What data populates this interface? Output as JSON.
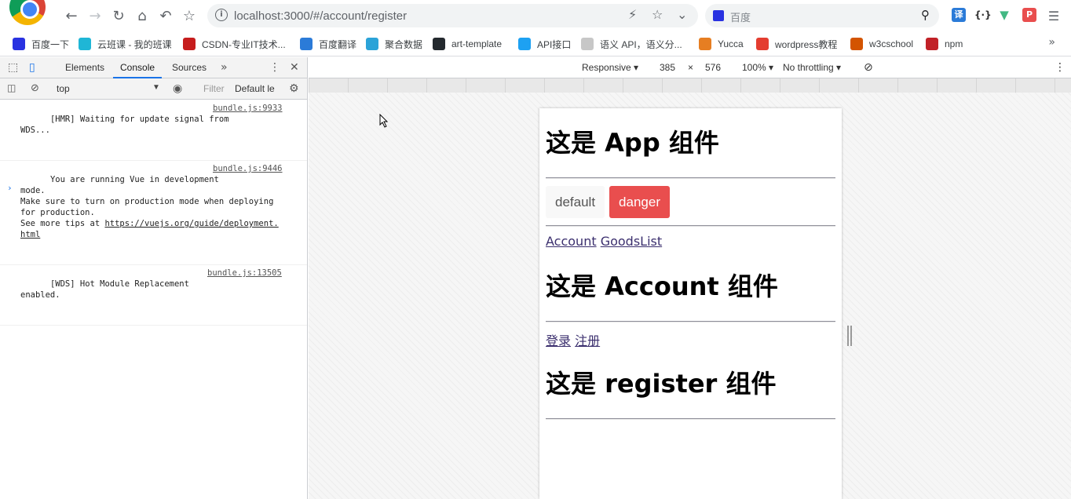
{
  "browser": {
    "url": "localhost:3000/#/account/register",
    "search_placeholder": "百度"
  },
  "bookmarks": [
    {
      "label": "百度一下",
      "color": "#2932e1"
    },
    {
      "label": "云班课 - 我的班课",
      "color": "#1fb6d6"
    },
    {
      "label": "CSDN-专业IT技术...",
      "color": "#c61d1d"
    },
    {
      "label": "百度翻译",
      "color": "#2b7bd8"
    },
    {
      "label": "聚合数据",
      "color": "#2ba3d8"
    },
    {
      "label": "art-template",
      "color": "#24292e"
    },
    {
      "label": "API接口",
      "color": "#1da1f2"
    },
    {
      "label": "语义 API，语义分...",
      "color": "#c7c7c7"
    },
    {
      "label": "Yucca",
      "color": "#e67e22"
    },
    {
      "label": "wordpress教程",
      "color": "#e43d30"
    },
    {
      "label": "w3cschool",
      "color": "#d35400"
    },
    {
      "label": "npm",
      "color": "#c12127"
    }
  ],
  "devtools": {
    "tabs": [
      "Elements",
      "Console",
      "Sources"
    ],
    "active_tab": "Console",
    "context": "top",
    "filter_placeholder": "Filter",
    "levels": "Default le",
    "messages": [
      {
        "text": "[HMR] Waiting for update signal from\nWDS...",
        "source": "bundle.js:9933"
      },
      {
        "text": "You are running Vue in development\nmode.\nMake sure to turn on production mode when deploying\nfor production.\nSee more tips at ",
        "link": "https://vuejs.org/guide/deployment.\nhtml",
        "source": "bundle.js:9446"
      },
      {
        "text": "[WDS] Hot Module Replacement\nenabled.",
        "source": "bundle.js:13505"
      }
    ]
  },
  "device_toolbar": {
    "mode": "Responsive",
    "width": "385",
    "height": "576",
    "zoom": "100%",
    "throttle": "No throttling"
  },
  "page": {
    "app_title": "这是 App 组件",
    "btn_default": "default",
    "btn_danger": "danger",
    "link_account": "Account",
    "link_goods": "GoodsList",
    "account_title": "这是 Account 组件",
    "link_login": "登录",
    "link_register": "注册",
    "register_title": "这是 register 组件"
  },
  "colors": {
    "accent": "#1a73e8",
    "danger": "#e94e4e"
  }
}
